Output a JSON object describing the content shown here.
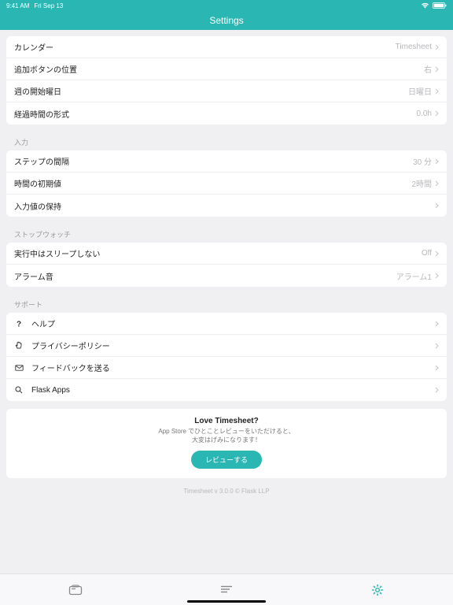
{
  "status": {
    "time": "9:41 AM",
    "date": "Fri Sep 13"
  },
  "header": {
    "title": "Settings"
  },
  "groups": {
    "general": {
      "rows": [
        {
          "label": "カレンダー",
          "value": "Timesheet"
        },
        {
          "label": "追加ボタンの位置",
          "value": "右"
        },
        {
          "label": "週の開始曜日",
          "value": "日曜日"
        },
        {
          "label": "経過時間の形式",
          "value": "0.0h"
        }
      ]
    },
    "input": {
      "header": "入力",
      "rows": [
        {
          "label": "ステップの間隔",
          "value": "30 分"
        },
        {
          "label": "時間の初期値",
          "value": "2時間"
        },
        {
          "label": "入力値の保持",
          "value": ""
        }
      ]
    },
    "stopwatch": {
      "header": "ストップウォッチ",
      "rows": [
        {
          "label": "実行中はスリープしない",
          "value": "Off"
        },
        {
          "label": "アラーム音",
          "value": "アラーム1"
        }
      ]
    },
    "support": {
      "header": "サポート",
      "rows": [
        {
          "label": "ヘルプ"
        },
        {
          "label": "プライバシーポリシー"
        },
        {
          "label": "フィードバックを送る"
        },
        {
          "label": "Flask Apps"
        }
      ]
    }
  },
  "promo": {
    "title": "Love Timesheet?",
    "line1": "App Store でひとことレビューをいただけると、",
    "line2": "大変はげみになります！",
    "button": "レビューする"
  },
  "footer": "Timesheet v 3.0.0 © Flask LLP"
}
